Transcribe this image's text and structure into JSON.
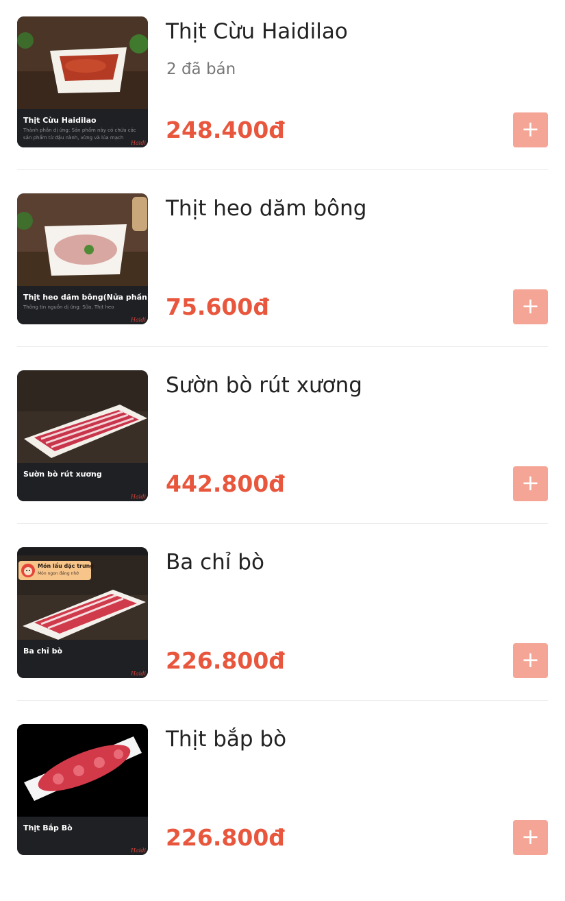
{
  "colors": {
    "price": "#e8573d",
    "add_button": "#f4a596",
    "thumb_caption_bg": "#1f2024"
  },
  "items": [
    {
      "name": "Thịt Cừu Haidilao",
      "sold": "2 đã bán",
      "price": "248.400đ",
      "add_icon": "plus-icon",
      "thumb": {
        "title": "Thịt Cừu Haidilao",
        "subtitle": "Thành phần dị ứng: Sản phẩm này có chứa các sản phẩm từ đậu nành, vừng và lúa mạch",
        "brand": "Haidi"
      }
    },
    {
      "name": "Thịt heo dăm bông",
      "price": "75.600đ",
      "add_icon": "plus-icon",
      "thumb": {
        "title": "Thịt heo dăm bông(Nửa phần)",
        "subtitle": "Thông tin nguồn dị ứng: Sữa,    Thịt heo",
        "brand": "Haidi"
      }
    },
    {
      "name": "Sườn bò rút xương",
      "price": "442.800đ",
      "add_icon": "plus-icon",
      "thumb": {
        "title": "Sườn bò rút xương",
        "brand": "Haidi"
      }
    },
    {
      "name": "Ba chỉ bò",
      "price": "226.800đ",
      "add_icon": "plus-icon",
      "thumb": {
        "title": "Ba chỉ bò",
        "badge_title": "Món lẩu đặc trưng",
        "badge_sub": "Món ngon đáng nhớ",
        "brand": "Haidi"
      }
    },
    {
      "name": "Thịt bắp bò",
      "price": "226.800đ",
      "add_icon": "plus-icon",
      "thumb": {
        "title": "Thịt Bắp Bò",
        "brand": "Haidi"
      }
    }
  ]
}
